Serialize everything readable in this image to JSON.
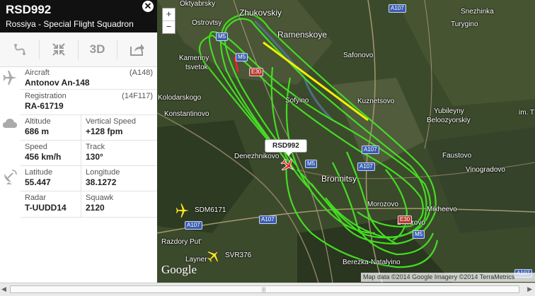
{
  "flight": {
    "callsign": "RSD992",
    "airline": "Rossiya - Special Flight Squadron",
    "aircraft_label": "Aircraft",
    "aircraft_code": "(A148)",
    "aircraft": "Antonov An-148",
    "registration_label": "Registration",
    "registration_code": "(14F117)",
    "registration": "RA-61719",
    "altitude_label": "Altitude",
    "altitude": "686 m",
    "vspeed_label": "Vertical Speed",
    "vspeed": "+128 fpm",
    "speed_label": "Speed",
    "speed": "456 km/h",
    "track_label": "Track",
    "track": "130°",
    "latitude_label": "Latitude",
    "latitude": "55.447",
    "longitude_label": "Longitude",
    "longitude": "38.1272",
    "radar_label": "Radar",
    "radar": "T-UUDD14",
    "squawk_label": "Squawk",
    "squawk": "2120"
  },
  "toolbar": {
    "route_icon": "route-icon",
    "fullscreen_icon": "collapse-icon",
    "view3d_label": "3D",
    "share_icon": "share-icon"
  },
  "map": {
    "zoom_in": "+",
    "zoom_out": "−",
    "selected_label": "RSD992",
    "other_flights": [
      "SDM6171",
      "SVR376"
    ],
    "places": [
      "Oktyabrsky",
      "Zhukovskiy",
      "Snezhinka",
      "Ostrovtsy",
      "Turygino",
      "Ramenskoye",
      "Kamenny",
      "tsvetok",
      "Safonovo",
      "Kolodarskogo",
      "Sofyino",
      "Kuznetsovo",
      "Konstantinovo",
      "Yubileyny",
      "Beloozyorskiy",
      "Denezhnikovo",
      "Faustovo",
      "Bronnitsy",
      "Vinogradovo",
      "Morozovo",
      "Mikheevo",
      "Dmitrovo",
      "Layner",
      "Berezka-Natalyino",
      "Razdory Put'",
      "im. T"
    ],
    "roads": [
      "A107",
      "M5",
      "E30",
      "M5",
      "A107",
      "A107",
      "A107",
      "M5",
      "E30",
      "M5",
      "A107",
      "A107"
    ],
    "google_logo": "Google",
    "attribution": "Map data ©2014 Google Imagery ©2014 TerraMetrics"
  },
  "colors": {
    "track": "#44dd22",
    "track_highlight": "#f2f200",
    "header_bg": "#111111",
    "marker": "#e8222a",
    "other_aircraft": "#f4e81a"
  }
}
